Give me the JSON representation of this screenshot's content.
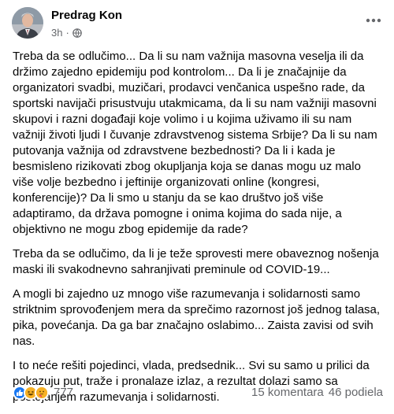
{
  "post": {
    "author": "Predrag Kon",
    "time": "3h",
    "separator": "·",
    "privacy_icon": "globe-icon",
    "more_icon": "more-options-icon",
    "paragraphs": [
      "Treba da se odlučimo... Da li su nam važnija masovna veselja ili da držimo zajedno epidemiju pod kontrolom... Da li je značajnije da organizatori svadbi, muzičari, prodavci venčanica uspešno rade, da sportski navijači prisustvuju utakmicama, da li su nam važniji masovni skupovi i razni događaji koje volimo i u kojima uživamo ili su nam važniji životi ljudi I čuvanje zdravstvenog sistema Srbije? Da li su nam putovanja važnija od zdravstvene bezbednosti? Da li i kada je besmisleno rizikovati zbog okupljanja koja se danas mogu uz malo više volje bezbedno i jeftinije organizovati online (kongresi, konferencije)? Da li smo u stanju da se kao društvo još više adaptiramo, da država pomogne i onima kojima do sada nije, a objektivno ne mogu zbog epidemije da rade?",
      "Treba da se odlučimo, da li je teže sprovesti mere obaveznog nošenja maski ili svakodnevno sahranjivati preminule od COVID-19...",
      "A mogli bi zajedno uz mnogo više razumevanja i solidarnosti samo striktnim sprovođenjem mera da sprečimo razornost još jednog talasa, pika, povećanja. Da ga bar značajno oslabimo... Zaista zavisi od svih nas.",
      "I to neće rešiti pojedinci, vlada, predsednik... Svi su samo u prilici da pokazuju put, traže i pronalaze izlaz, a rezultat dolazi samo sa postojanjem razumevanja i solidarnosti."
    ]
  },
  "footer": {
    "reaction_icons": [
      "like-icon",
      "haha-icon",
      "care-icon"
    ],
    "reaction_count": "777",
    "comments": "15 komentara",
    "shares": "46 podiela"
  },
  "colors": {
    "like": "#1877f2",
    "muted_text": "#65676b",
    "text": "#050505"
  }
}
